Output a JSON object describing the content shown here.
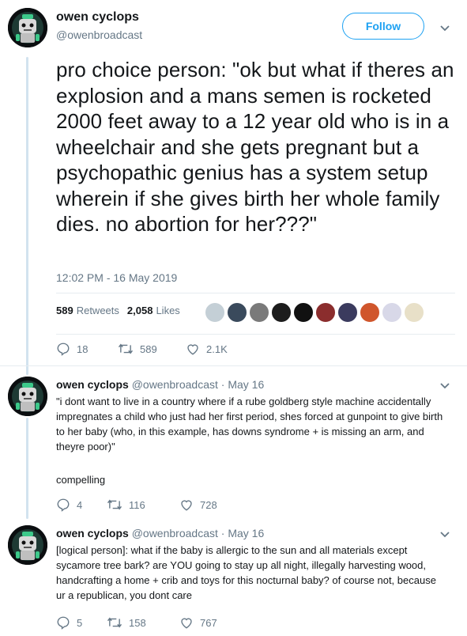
{
  "main_tweet": {
    "display_name": "owen cyclops",
    "handle": "@owenbroadcast",
    "follow_label": "Follow",
    "text": "pro choice person: \"ok but what if theres an explosion and a mans semen is rocketed 2000 feet away to a 12 year old who is in a wheelchair and she gets pregnant but a psychopathic genius has a system setup wherein if she gives birth her whole family dies. no abortion for her???\"",
    "timestamp": "12:02 PM - 16 May 2019",
    "retweets_count": "589",
    "retweets_label": "Retweets",
    "likes_count": "2,058",
    "likes_label": "Likes",
    "actions": {
      "replies": "18",
      "retweets": "589",
      "likes": "2.1K"
    }
  },
  "replies": [
    {
      "display_name": "owen cyclops",
      "handle": "@owenbroadcast",
      "separator": "·",
      "date": "May 16",
      "text": "\"i dont want to live in a country where if a rube goldberg style machine accidentally impregnates a child who just had her first period, shes forced at gunpoint to give birth to her baby (who, in this example, has downs syndrome + is missing an arm, and theyre poor)\"",
      "text2": "compelling",
      "actions": {
        "replies": "4",
        "retweets": "116",
        "likes": "728"
      }
    },
    {
      "display_name": "owen cyclops",
      "handle": "@owenbroadcast",
      "separator": "·",
      "date": "May 16",
      "text": "[logical person]: what if the baby is allergic to the sun and all materials except sycamore tree bark? are YOU going to stay up all night, illegally harvesting wood, handcrafting a home + crib and toys for this nocturnal baby? of course not, because ur a republican, you dont care",
      "actions": {
        "replies": "5",
        "retweets": "158",
        "likes": "767"
      }
    }
  ],
  "icons": {
    "reply": "reply-icon",
    "retweet": "retweet-icon",
    "like": "heart-icon",
    "caret": "chevron-down-icon"
  },
  "colors": {
    "accent": "#1da1f2",
    "muted": "#657786",
    "thread_line": "#d2e3ef",
    "avatar_bg": "#0b0e10"
  }
}
